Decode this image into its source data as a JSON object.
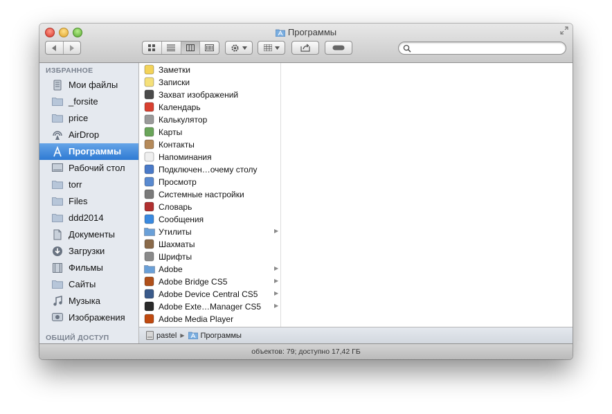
{
  "window": {
    "title": "Программы"
  },
  "search": {
    "placeholder": ""
  },
  "sidebar": {
    "favorites_header": "ИЗБРАННОЕ",
    "shared_header": "ОБЩИЙ ДОСТУП",
    "items": [
      {
        "label": "Мои файлы",
        "icon": "all-my-files-icon"
      },
      {
        "label": "_forsite",
        "icon": "folder-icon"
      },
      {
        "label": "price",
        "icon": "folder-icon"
      },
      {
        "label": "AirDrop",
        "icon": "airdrop-icon"
      },
      {
        "label": "Программы",
        "icon": "applications-icon",
        "selected": true
      },
      {
        "label": "Рабочий стол",
        "icon": "desktop-icon"
      },
      {
        "label": "torr",
        "icon": "folder-icon"
      },
      {
        "label": "Files",
        "icon": "folder-icon"
      },
      {
        "label": "ddd2014",
        "icon": "folder-icon"
      },
      {
        "label": "Документы",
        "icon": "documents-icon"
      },
      {
        "label": "Загрузки",
        "icon": "downloads-icon"
      },
      {
        "label": "Фильмы",
        "icon": "movies-icon"
      },
      {
        "label": "Сайты",
        "icon": "folder-icon"
      },
      {
        "label": "Музыка",
        "icon": "music-icon"
      },
      {
        "label": "Изображения",
        "icon": "pictures-icon"
      }
    ]
  },
  "column": {
    "items": [
      {
        "label": "Заметки",
        "icon": "notes-icon",
        "color": "#f3d35a"
      },
      {
        "label": "Записки",
        "icon": "stickies-icon",
        "color": "#f5e07a"
      },
      {
        "label": "Захват изображений",
        "icon": "image-capture-icon",
        "color": "#4a4a4a"
      },
      {
        "label": "Календарь",
        "icon": "calendar-icon",
        "color": "#d84030"
      },
      {
        "label": "Калькулятор",
        "icon": "calculator-icon",
        "color": "#9a9a9a"
      },
      {
        "label": "Карты",
        "icon": "maps-icon",
        "color": "#6aa55a"
      },
      {
        "label": "Контакты",
        "icon": "contacts-icon",
        "color": "#b58a5a"
      },
      {
        "label": "Напоминания",
        "icon": "reminders-icon",
        "color": "#efefef"
      },
      {
        "label": "Подключен…очему столу",
        "icon": "remote-desktop-icon",
        "color": "#4a7ac8"
      },
      {
        "label": "Просмотр",
        "icon": "preview-icon",
        "color": "#5a8ad0"
      },
      {
        "label": "Системные настройки",
        "icon": "system-preferences-icon",
        "color": "#7a7a7a"
      },
      {
        "label": "Словарь",
        "icon": "dictionary-icon",
        "color": "#b03030"
      },
      {
        "label": "Сообщения",
        "icon": "messages-icon",
        "color": "#3a8ae0"
      },
      {
        "label": "Утилиты",
        "icon": "utilities-folder-icon",
        "color": "#6aa0d8",
        "arrow": true
      },
      {
        "label": "Шахматы",
        "icon": "chess-icon",
        "color": "#8a6a4a"
      },
      {
        "label": "Шрифты",
        "icon": "font-book-icon",
        "color": "#8a8a8a"
      },
      {
        "label": "Adobe",
        "icon": "folder-icon",
        "color": "#6aa0d8",
        "arrow": true
      },
      {
        "label": "Adobe Bridge CS5",
        "icon": "adobe-bridge-icon",
        "color": "#b0501a",
        "arrow": true
      },
      {
        "label": "Adobe Device Central CS5",
        "icon": "adobe-device-central-icon",
        "color": "#3a5a8a",
        "arrow": true
      },
      {
        "label": "Adobe Exte…Manager CS5",
        "icon": "adobe-extension-manager-icon",
        "color": "#2a2a2a",
        "arrow": true
      },
      {
        "label": "Adobe Media Player",
        "icon": "adobe-media-player-icon",
        "color": "#c04a10"
      }
    ],
    "arrow_glyph": "▶"
  },
  "pathbar": {
    "items": [
      {
        "label": "pastel",
        "icon": "hard-drive-icon"
      },
      {
        "label": "Программы",
        "icon": "applications-icon"
      }
    ],
    "separator": "▶"
  },
  "status": {
    "text": "объектов: 79; доступно 17,42 ГБ"
  },
  "colors": {
    "selection": "#2e7ad3",
    "sidebar_bg": "#e5e9ef"
  }
}
